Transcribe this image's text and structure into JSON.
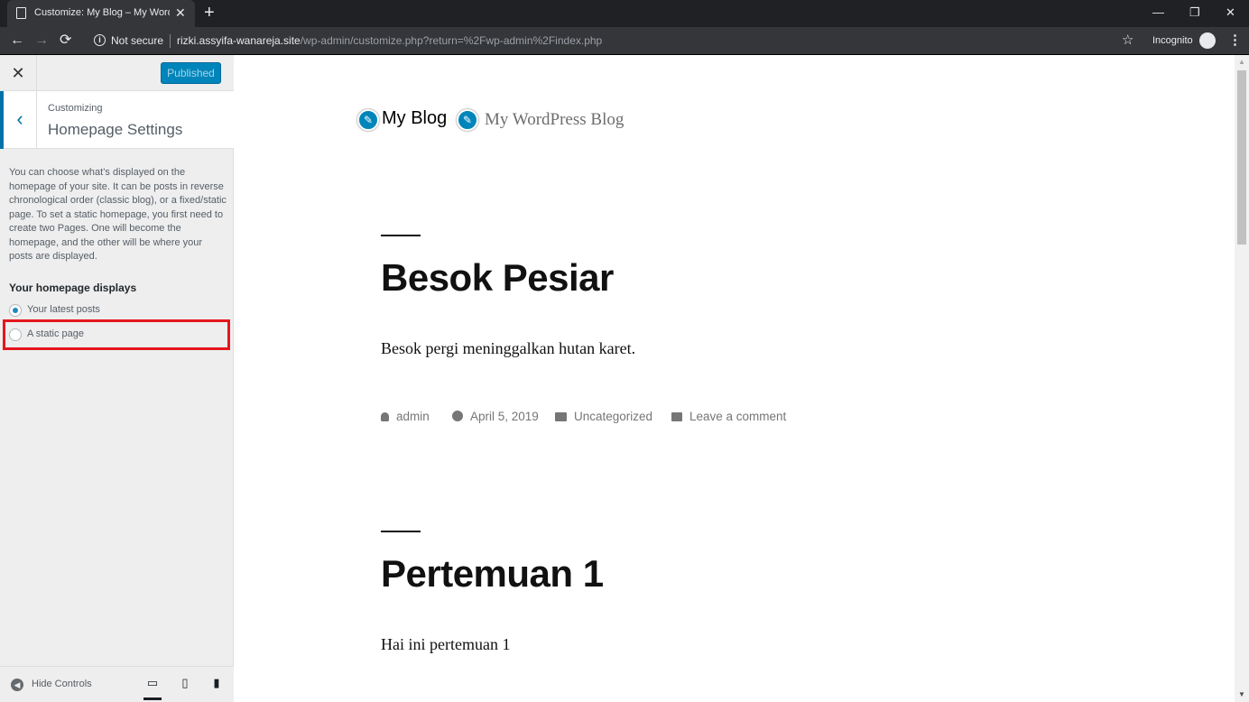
{
  "browser": {
    "tab_title": "Customize: My Blog – My WordP",
    "tab_close": "✕",
    "new_tab": "+",
    "win_minimize": "—",
    "win_restore": "❐",
    "win_close": "✕",
    "back": "←",
    "forward": "→",
    "reload": "⟳",
    "security_label": "Not secure",
    "url_host": "rizki.assyifa-wanareja.site",
    "url_path": "/wp-admin/customize.php?return=%2Fwp-admin%2Findex.php",
    "bookmark": "☆",
    "mode_label": "Incognito",
    "menu": "⋮"
  },
  "customizer": {
    "close": "✕",
    "publish_label": "Published",
    "back": "‹",
    "breadcrumb": "Customizing",
    "section_title": "Homepage Settings",
    "description": "You can choose what’s displayed on the homepage of your site. It can be posts in reverse chronological order (classic blog), or a fixed/static page. To set a static homepage, you first need to create two Pages. One will become the homepage, and the other will be where your posts are displayed.",
    "control_title": "Your homepage displays",
    "options": [
      {
        "label": "Your latest posts",
        "checked": true
      },
      {
        "label": "A static page",
        "checked": false
      }
    ],
    "hide_controls": "Hide Controls",
    "accent_color": "#0073aa",
    "highlight_color": "#e5161d"
  },
  "preview": {
    "pencil": "✎",
    "site_title": "My Blog",
    "site_description": "My WordPress Blog",
    "posts": [
      {
        "title": "Besok Pesiar",
        "excerpt": "Besok pergi meninggalkan hutan karet.",
        "author": "admin",
        "date": "April 5, 2019",
        "category": "Uncategorized",
        "comments": "Leave a comment"
      },
      {
        "title": "Pertemuan 1",
        "excerpt": "Hai ini pertemuan 1"
      }
    ]
  }
}
